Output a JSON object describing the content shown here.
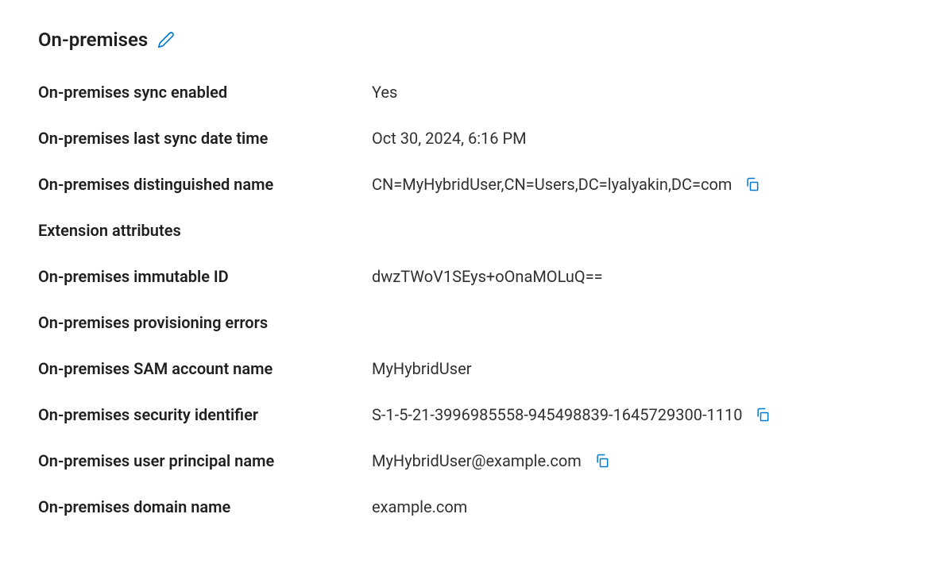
{
  "section": {
    "title": "On-premises"
  },
  "properties": {
    "sync_enabled": {
      "label": "On-premises sync enabled",
      "value": "Yes"
    },
    "last_sync": {
      "label": "On-premises last sync date time",
      "value": "Oct 30, 2024, 6:16 PM"
    },
    "distinguished_name": {
      "label": "On-premises distinguished name",
      "value": "CN=MyHybridUser,CN=Users,DC=lyalyakin,DC=com"
    },
    "extension_attributes": {
      "label": "Extension attributes",
      "value": ""
    },
    "immutable_id": {
      "label": "On-premises immutable ID",
      "value": "dwzTWoV1SEys+oOnaMOLuQ=="
    },
    "provisioning_errors": {
      "label": "On-premises provisioning errors",
      "value": ""
    },
    "sam_account_name": {
      "label": "On-premises SAM account name",
      "value": "MyHybridUser"
    },
    "security_identifier": {
      "label": "On-premises security identifier",
      "value": "S-1-5-21-3996985558-945498839-1645729300-1110"
    },
    "user_principal_name": {
      "label": "On-premises user principal name",
      "value": "MyHybridUser@example.com"
    },
    "domain_name": {
      "label": "On-premises domain name",
      "value": "example.com"
    }
  }
}
